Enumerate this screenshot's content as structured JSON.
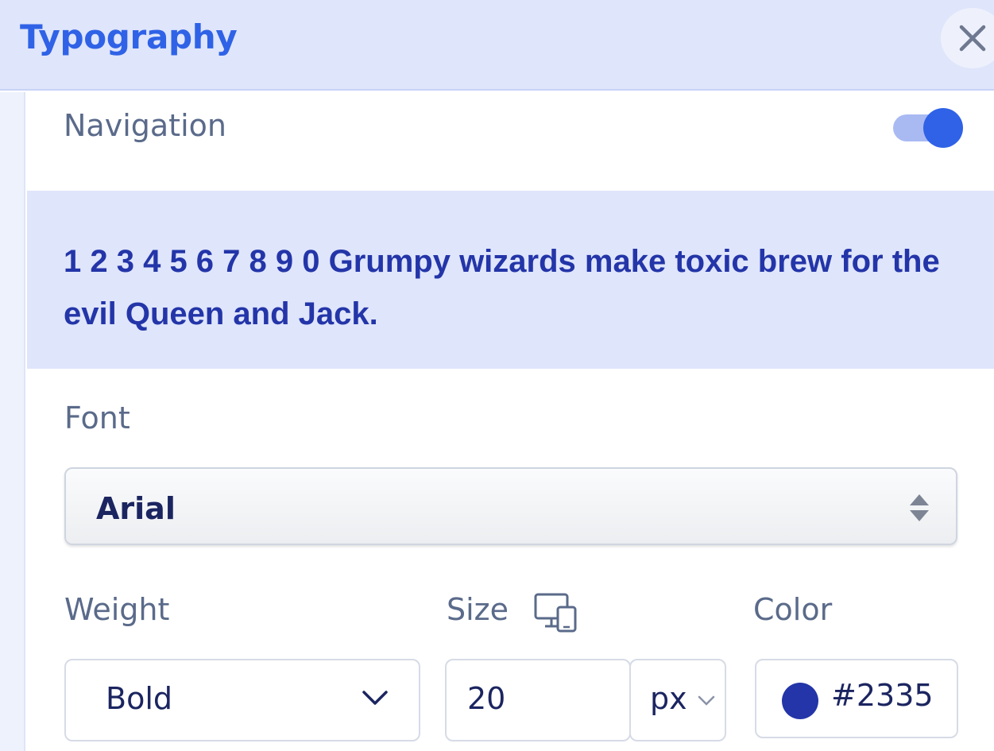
{
  "header": {
    "title": "Typography",
    "close_icon": "close-icon"
  },
  "navigation": {
    "label": "Navigation",
    "toggle_on": true
  },
  "preview": {
    "text": "1 2 3 4 5 6 7 8 9 0 Grumpy wizards make toxic brew for the evil Queen and Jack."
  },
  "font": {
    "label": "Font",
    "value": "Arial",
    "icon": "updown-arrows-icon"
  },
  "weight": {
    "label": "Weight",
    "value": "Bold",
    "icon": "chevron-down-icon"
  },
  "size": {
    "label": "Size",
    "value": "20",
    "unit": "px",
    "responsive_icon": "devices-icon"
  },
  "color": {
    "label": "Color",
    "value": "#2335",
    "swatch": "#2335a8"
  },
  "colors": {
    "accent": "#2f62e6",
    "header_bg": "#dfe5fb",
    "preview_text": "#2335a8"
  }
}
